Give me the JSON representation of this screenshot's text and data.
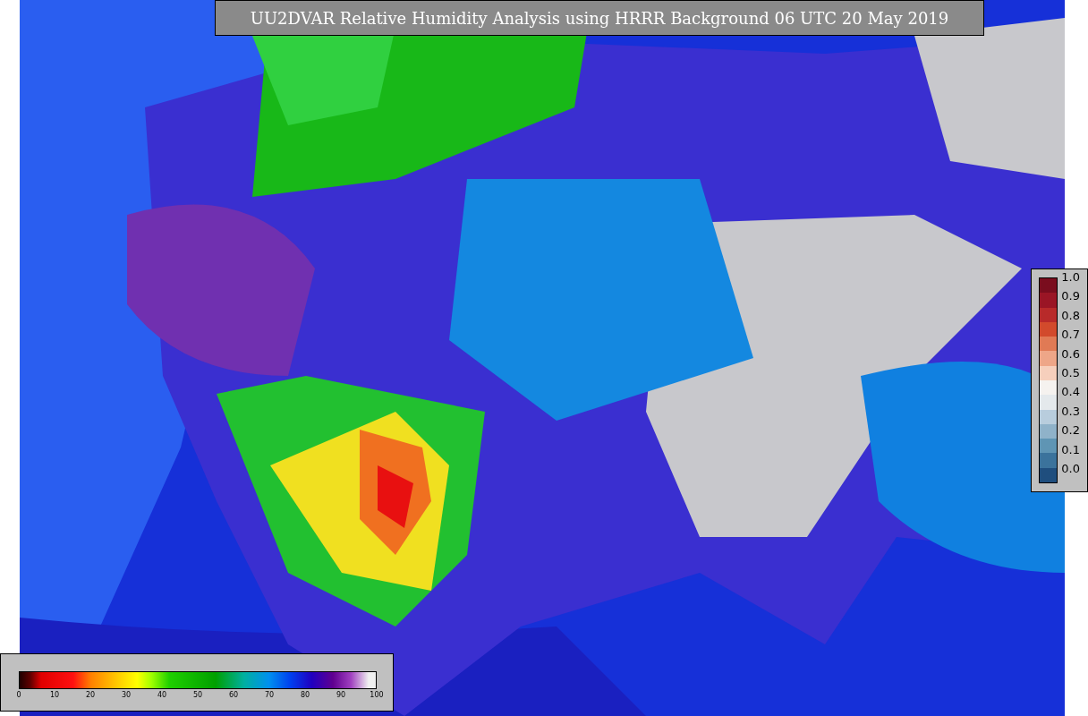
{
  "title": "UU2DVAR Relative Humidity Analysis using HRRR Background 06 UTC 20 May 2019",
  "station_colorbar": {
    "ticks": [
      "1.0",
      "0.9",
      "0.8",
      "0.7",
      "0.6",
      "0.5",
      "0.4",
      "0.3",
      "0.2",
      "0.1",
      "0.0"
    ]
  },
  "humidity_colorbar": {
    "ticks": [
      "0",
      "10",
      "20",
      "30",
      "40",
      "50",
      "60",
      "70",
      "80",
      "90",
      "100"
    ]
  }
}
